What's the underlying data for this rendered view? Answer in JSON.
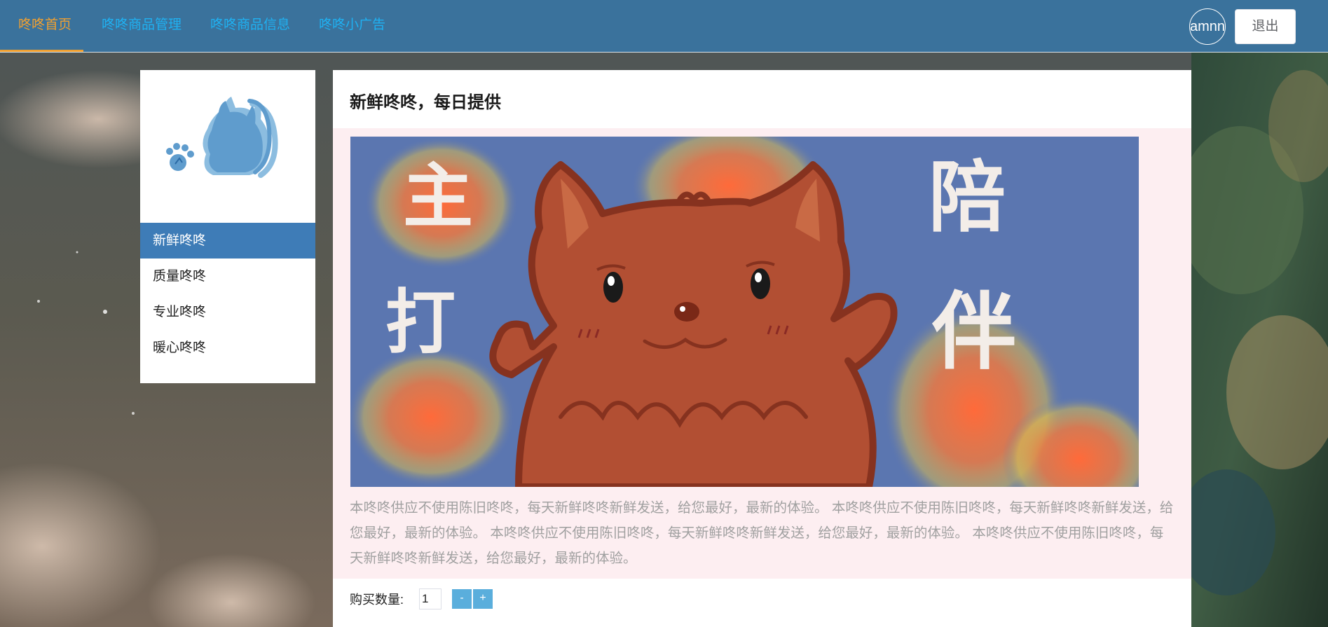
{
  "nav": {
    "items": [
      {
        "label": "咚咚首页",
        "active": true
      },
      {
        "label": "咚咚商品管理",
        "active": false
      },
      {
        "label": "咚咚商品信息",
        "active": false
      },
      {
        "label": "咚咚小广告",
        "active": false
      }
    ],
    "user_avatar_text": "amnn",
    "logout_label": "退出"
  },
  "sidebar": {
    "logo_icon": "cat-paw-logo-icon",
    "items": [
      {
        "label": "新鲜咚咚",
        "active": true
      },
      {
        "label": "质量咚咚",
        "active": false
      },
      {
        "label": "专业咚咚",
        "active": false
      },
      {
        "label": "暖心咚咚",
        "active": false
      }
    ]
  },
  "main": {
    "title": "新鲜咚咚，每日提供",
    "banner": {
      "left_text": [
        "主",
        "打"
      ],
      "right_text": [
        "陪",
        "伴"
      ]
    },
    "description": "本咚咚供应不使用陈旧咚咚，每天新鲜咚咚新鲜发送，给您最好，最新的体验。 本咚咚供应不使用陈旧咚咚，每天新鲜咚咚新鲜发送，给您最好，最新的体验。 本咚咚供应不使用陈旧咚咚，每天新鲜咚咚新鲜发送，给您最好，最新的体验。 本咚咚供应不使用陈旧咚咚，每天新鲜咚咚新鲜发送，给您最好，最新的体验。",
    "quantity": {
      "label": "购买数量:",
      "value": "1",
      "decrement_label": "-",
      "increment_label": "+"
    }
  },
  "colors": {
    "navbar": "#3a729c",
    "nav_active": "#f0a031",
    "nav_link": "#1fb1f2",
    "sidebar_active": "#3e7cb7",
    "pink_area": "#fdeef1",
    "qty_button": "#5aaedc"
  }
}
